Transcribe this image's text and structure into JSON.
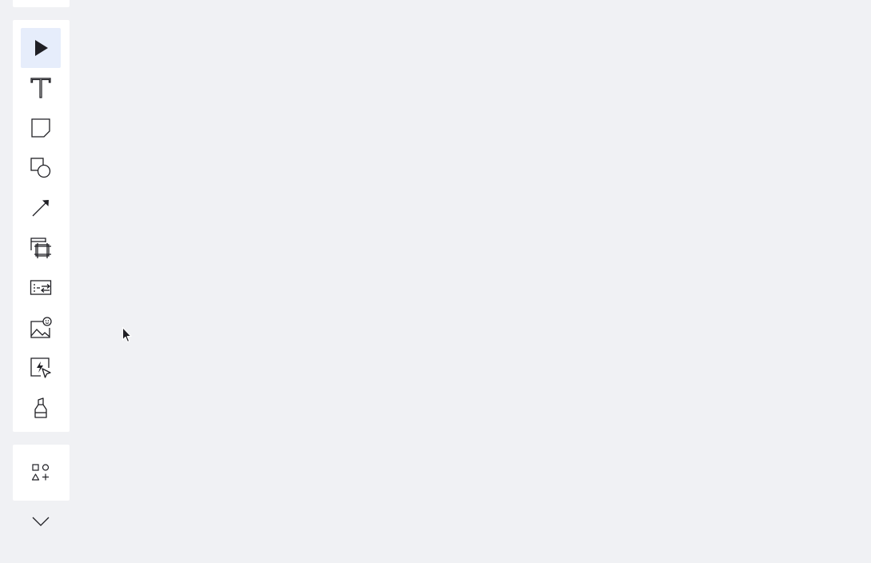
{
  "toolbar": {
    "tools": [
      {
        "id": "select",
        "icon": "select-arrow-icon",
        "active": true
      },
      {
        "id": "text",
        "icon": "text-icon",
        "active": false
      },
      {
        "id": "sticky-note",
        "icon": "sticky-note-icon",
        "active": false
      },
      {
        "id": "shapes",
        "icon": "shapes-icon",
        "active": false
      },
      {
        "id": "connection-line",
        "icon": "connection-line-icon",
        "active": false
      },
      {
        "id": "frame",
        "icon": "frame-icon",
        "active": false
      },
      {
        "id": "templates",
        "icon": "templates-icon",
        "active": false
      },
      {
        "id": "image",
        "icon": "image-icon",
        "active": false
      },
      {
        "id": "interactive",
        "icon": "interactive-icon",
        "active": false
      },
      {
        "id": "marker",
        "icon": "marker-icon",
        "active": false
      }
    ],
    "extra_tool": {
      "id": "more-apps",
      "icon": "more-apps-icon"
    },
    "collapse_toggle": {
      "icon": "chevron-down-icon"
    }
  },
  "colors": {
    "canvas_background": "#f0f1f4",
    "panel_background": "#ffffff",
    "active_tool_background": "#e6edfb",
    "icon_color": "#1f1f24"
  }
}
